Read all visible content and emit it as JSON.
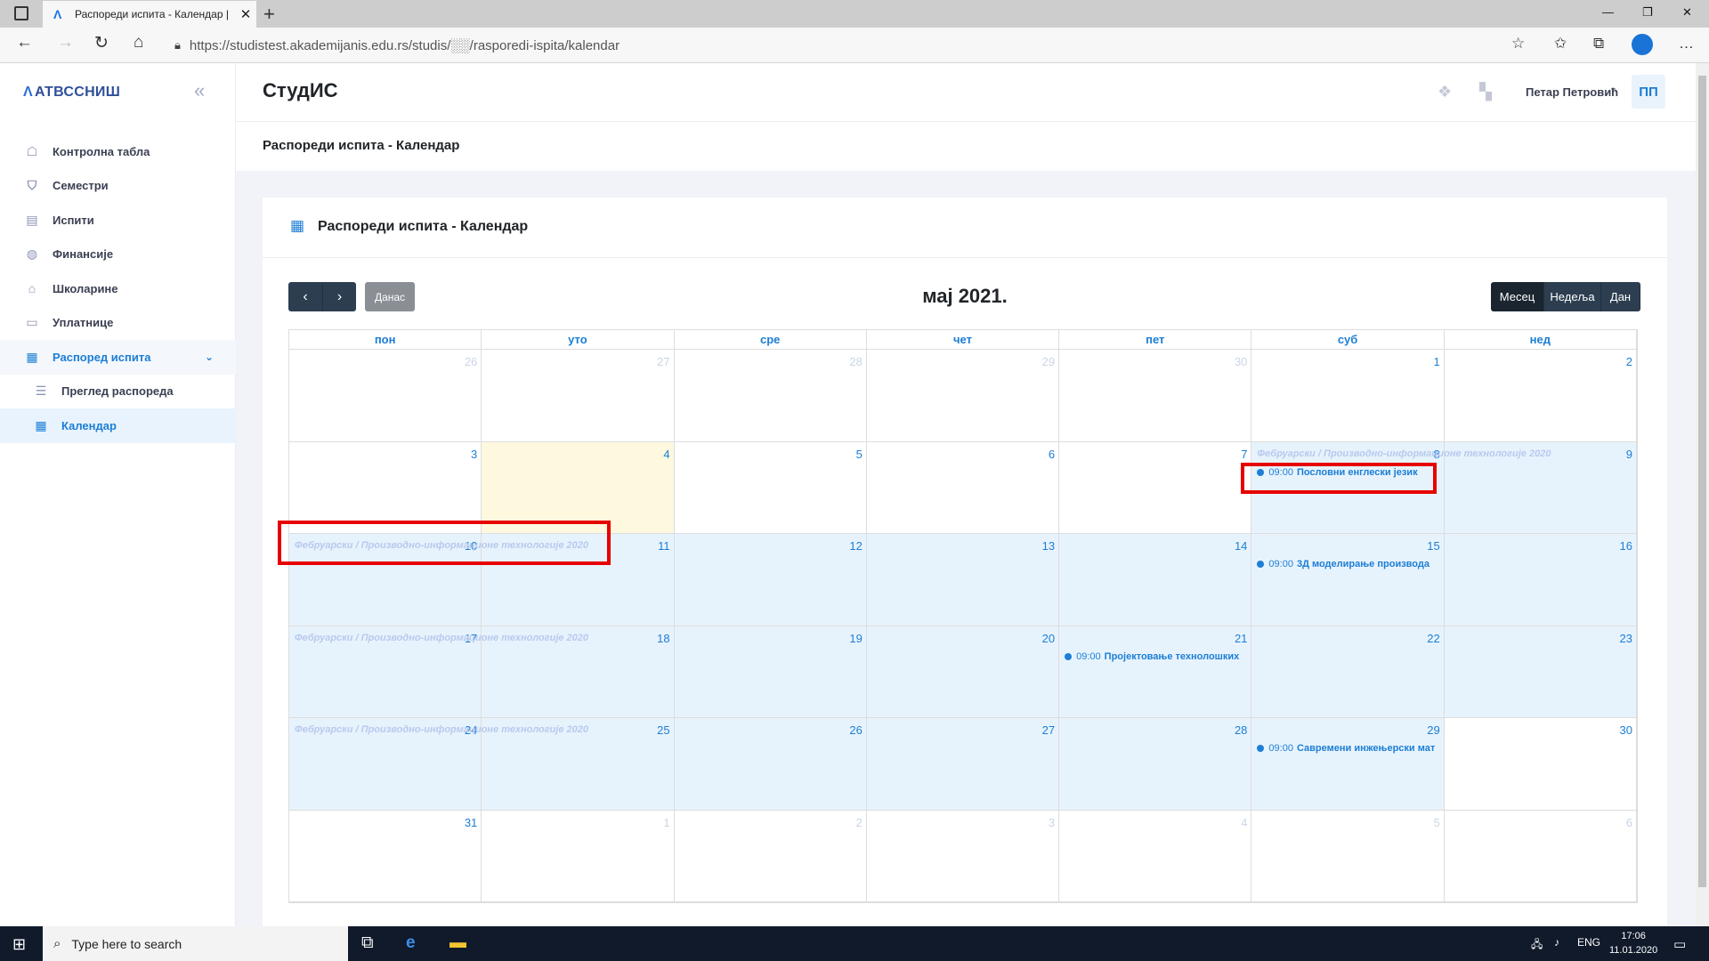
{
  "browser": {
    "tab_title": "Распореди испита - Календар |",
    "url": "https://studistest.akademijanis.edu.rs/studis/░░/rasporedi-ispita/kalendar"
  },
  "sidebar": {
    "logo": "АТВССНИШ",
    "items": [
      {
        "label": "Контролна табла",
        "icon": "dashboard-icon"
      },
      {
        "label": "Семестри",
        "icon": "basket-icon"
      },
      {
        "label": "Испити",
        "icon": "document-icon"
      },
      {
        "label": "Финансије",
        "icon": "coins-icon"
      },
      {
        "label": "Школарине",
        "icon": "graduation-cap-icon"
      },
      {
        "label": "Уплатнице",
        "icon": "id-card-icon"
      },
      {
        "label": "Распоред испита",
        "icon": "calendar-icon"
      }
    ],
    "subitems": [
      {
        "label": "Преглед распореда",
        "icon": "list-icon"
      },
      {
        "label": "Календар",
        "icon": "calendar-icon"
      }
    ]
  },
  "header": {
    "app_title": "СтудИС",
    "user_name": "Петар Петровић",
    "user_initials": "ПП"
  },
  "subheader": {
    "title": "Распореди испита - Календар"
  },
  "card": {
    "title": "Распореди испита - Календар"
  },
  "calendar": {
    "month_title": "мај 2021.",
    "today_label": "Данас",
    "views": [
      "Месец",
      "Недеља",
      "Дан"
    ],
    "active_view": "Месец",
    "weekdays": [
      "пон",
      "уто",
      "сре",
      "чет",
      "пет",
      "суб",
      "нед"
    ],
    "weeks": [
      [
        {
          "d": "26",
          "o": true
        },
        {
          "d": "27",
          "o": true
        },
        {
          "d": "28",
          "o": true
        },
        {
          "d": "29",
          "o": true
        },
        {
          "d": "30",
          "o": true
        },
        {
          "d": "1"
        },
        {
          "d": "2"
        }
      ],
      [
        {
          "d": "3"
        },
        {
          "d": "4",
          "today": true
        },
        {
          "d": "5"
        },
        {
          "d": "6"
        },
        {
          "d": "7"
        },
        {
          "d": "8",
          "hl": true
        },
        {
          "d": "9",
          "hl": true
        }
      ],
      [
        {
          "d": "10",
          "hl": true
        },
        {
          "d": "11",
          "hl": true
        },
        {
          "d": "12",
          "hl": true
        },
        {
          "d": "13",
          "hl": true
        },
        {
          "d": "14",
          "hl": true
        },
        {
          "d": "15",
          "hl": true
        },
        {
          "d": "16",
          "hl": true
        }
      ],
      [
        {
          "d": "17",
          "hl": true
        },
        {
          "d": "18",
          "hl": true
        },
        {
          "d": "19",
          "hl": true
        },
        {
          "d": "20",
          "hl": true
        },
        {
          "d": "21",
          "hl": true
        },
        {
          "d": "22",
          "hl": true
        },
        {
          "d": "23",
          "hl": true
        }
      ],
      [
        {
          "d": "24",
          "hl": true
        },
        {
          "d": "25",
          "hl": true
        },
        {
          "d": "26",
          "hl": true
        },
        {
          "d": "27",
          "hl": true
        },
        {
          "d": "28",
          "hl": true
        },
        {
          "d": "29",
          "hl": true
        },
        {
          "d": "30"
        }
      ],
      [
        {
          "d": "31"
        },
        {
          "d": "1",
          "o": true
        },
        {
          "d": "2",
          "o": true
        },
        {
          "d": "3",
          "o": true
        },
        {
          "d": "4",
          "o": true
        },
        {
          "d": "5",
          "o": true
        },
        {
          "d": "6",
          "o": true
        }
      ]
    ],
    "background_event": "Фебруарски / Производно-информационе технологије 2020",
    "events": [
      {
        "time": "09:00",
        "name": "Пословни енглески језик",
        "week": 1,
        "day": 5
      },
      {
        "time": "09:00",
        "name": "3Д моделирање производа",
        "week": 2,
        "day": 5
      },
      {
        "time": "09:00",
        "name": "Пројектовање технолошких",
        "week": 3,
        "day": 4
      },
      {
        "time": "09:00",
        "name": "Савремени инжењерски мат",
        "week": 4,
        "day": 5
      }
    ]
  },
  "taskbar": {
    "search_placeholder": "Type here to search",
    "lang": "ENG",
    "time": "17:06",
    "date": "11.01.2020"
  }
}
